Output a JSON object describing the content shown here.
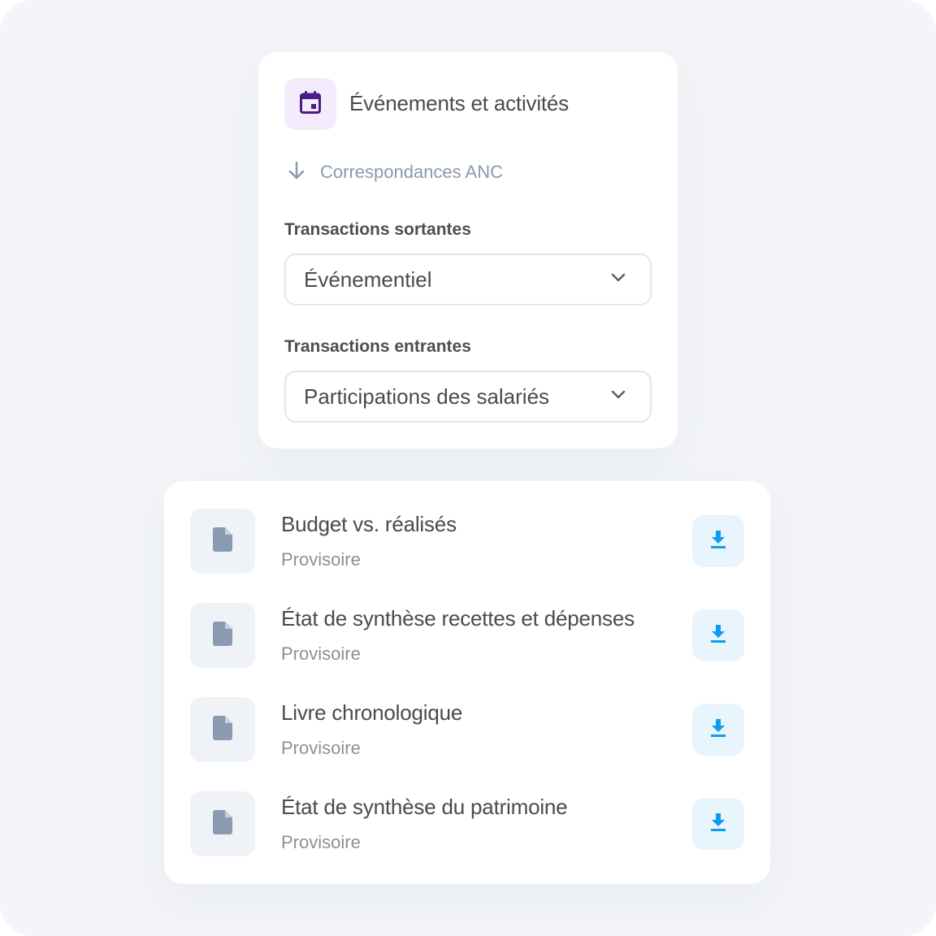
{
  "event_card": {
    "title": "Événements et activités",
    "icon": "calendar-icon",
    "icon_color": "#4b1e85",
    "icon_bg": "#f4ecfc",
    "correspondance": {
      "icon": "arrow-down-icon",
      "label": "Correspondances ANC"
    },
    "outgoing": {
      "label": "Transactions sortantes",
      "value": "Événementiel"
    },
    "incoming": {
      "label": "Transactions entrantes",
      "value": "Participations des salariés"
    }
  },
  "documents": {
    "download_icon_color": "#109bf0",
    "file_icon_color": "#8a9ab0",
    "items": [
      {
        "title": "Budget vs. réalisés",
        "status": "Provisoire"
      },
      {
        "title": "État de synthèse recettes et dépenses",
        "status": "Provisoire"
      },
      {
        "title": "Livre chronologique",
        "status": "Provisoire"
      },
      {
        "title": "État de synthèse du patrimoine",
        "status": "Provisoire"
      }
    ]
  }
}
